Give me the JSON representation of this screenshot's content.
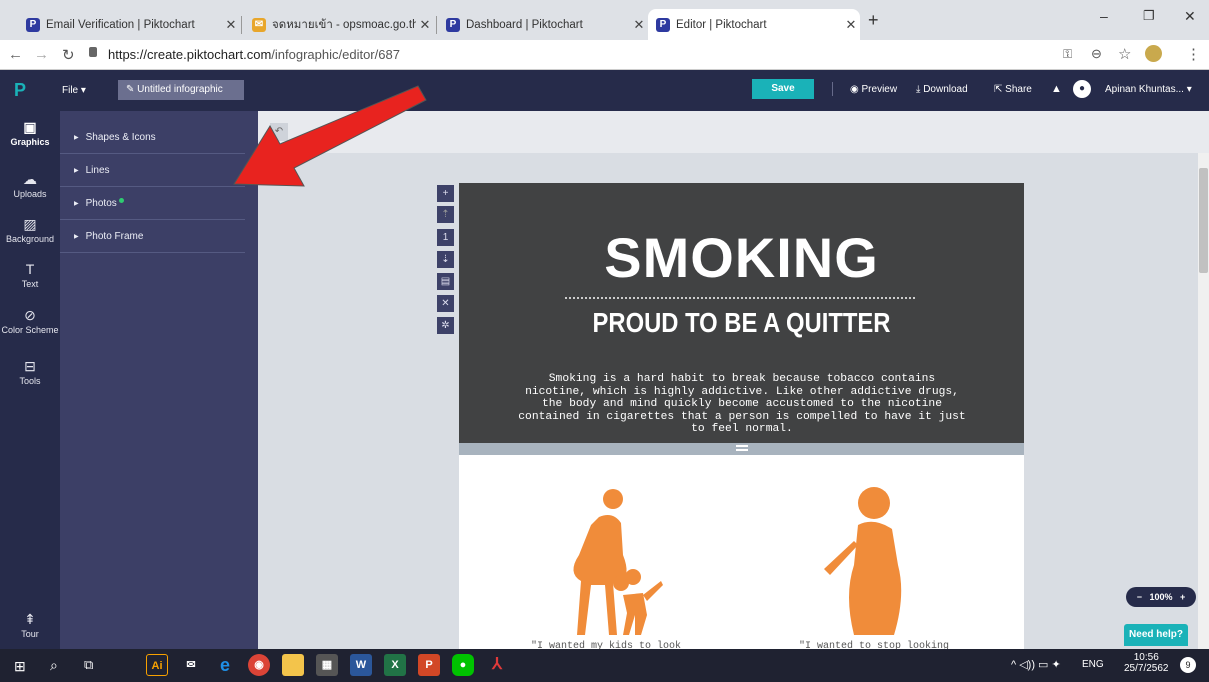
{
  "browser": {
    "tabs": [
      {
        "title": "Email Verification | Piktochart",
        "active": false
      },
      {
        "title": "จดหมายเข้า - opsmoac.go.th - Sm",
        "active": false
      },
      {
        "title": "Dashboard | Piktochart",
        "active": false
      },
      {
        "title": "Editor | Piktochart",
        "active": true
      }
    ],
    "new_tab": "+",
    "url_host": "https://create.piktochart.com",
    "url_path": "/infographic/editor/687"
  },
  "app": {
    "file_menu": "File",
    "doc_title": "Untitled infographic",
    "save": "Save",
    "preview": "Preview",
    "download": "Download",
    "share": "Share",
    "user": "Apinan Khuntas..."
  },
  "leftnav": [
    {
      "label": "Graphics",
      "icon": "image-icon"
    },
    {
      "label": "Uploads",
      "icon": "cloud-upload-icon"
    },
    {
      "label": "Background",
      "icon": "pattern-icon"
    },
    {
      "label": "Text",
      "icon": "text-icon"
    },
    {
      "label": "Color Scheme",
      "icon": "palette-icon"
    },
    {
      "label": "Tools",
      "icon": "toolbox-icon"
    },
    {
      "label": "Tour",
      "icon": "signpost-icon"
    }
  ],
  "panel": [
    "Shapes & Icons",
    "Lines",
    "Photos",
    "Photo Frame"
  ],
  "infographic": {
    "title": "SMOKING",
    "subtitle": "PROUD TO BE A QUITTER",
    "body": "Smoking is a hard habit to break because tobacco contains nicotine, which is highly addictive. Like other addictive drugs, the body and mind quickly become accustomed to the nicotine contained in cigarettes that a person is compelled to have it just to feel normal.",
    "quote_left": "\"I wanted my kids to look",
    "quote_right": "\"I wanted to stop looking"
  },
  "zoom": "100%",
  "help": "Need help?",
  "taskbar": {
    "lang": "ENG",
    "time": "10:56",
    "date": "25/7/2562",
    "notif": "9"
  },
  "colors": {
    "accent": "#1ab2b8",
    "header": "#262b4a",
    "panel": "#3c3f66",
    "orange": "#f08c3a",
    "arrow": "#e8231f"
  }
}
